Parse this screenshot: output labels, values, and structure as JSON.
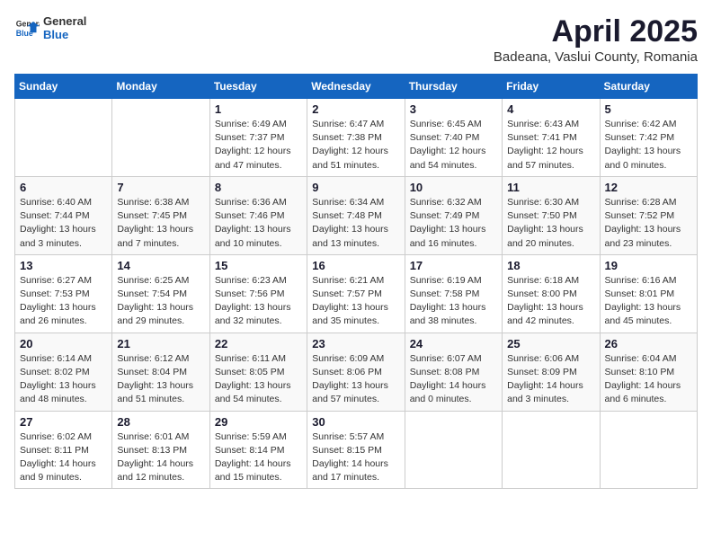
{
  "header": {
    "logo_general": "General",
    "logo_blue": "Blue",
    "title": "April 2025",
    "subtitle": "Badeana, Vaslui County, Romania"
  },
  "calendar": {
    "days_of_week": [
      "Sunday",
      "Monday",
      "Tuesday",
      "Wednesday",
      "Thursday",
      "Friday",
      "Saturday"
    ],
    "weeks": [
      [
        {
          "day": "",
          "detail": ""
        },
        {
          "day": "",
          "detail": ""
        },
        {
          "day": "1",
          "detail": "Sunrise: 6:49 AM\nSunset: 7:37 PM\nDaylight: 12 hours\nand 47 minutes."
        },
        {
          "day": "2",
          "detail": "Sunrise: 6:47 AM\nSunset: 7:38 PM\nDaylight: 12 hours\nand 51 minutes."
        },
        {
          "day": "3",
          "detail": "Sunrise: 6:45 AM\nSunset: 7:40 PM\nDaylight: 12 hours\nand 54 minutes."
        },
        {
          "day": "4",
          "detail": "Sunrise: 6:43 AM\nSunset: 7:41 PM\nDaylight: 12 hours\nand 57 minutes."
        },
        {
          "day": "5",
          "detail": "Sunrise: 6:42 AM\nSunset: 7:42 PM\nDaylight: 13 hours\nand 0 minutes."
        }
      ],
      [
        {
          "day": "6",
          "detail": "Sunrise: 6:40 AM\nSunset: 7:44 PM\nDaylight: 13 hours\nand 3 minutes."
        },
        {
          "day": "7",
          "detail": "Sunrise: 6:38 AM\nSunset: 7:45 PM\nDaylight: 13 hours\nand 7 minutes."
        },
        {
          "day": "8",
          "detail": "Sunrise: 6:36 AM\nSunset: 7:46 PM\nDaylight: 13 hours\nand 10 minutes."
        },
        {
          "day": "9",
          "detail": "Sunrise: 6:34 AM\nSunset: 7:48 PM\nDaylight: 13 hours\nand 13 minutes."
        },
        {
          "day": "10",
          "detail": "Sunrise: 6:32 AM\nSunset: 7:49 PM\nDaylight: 13 hours\nand 16 minutes."
        },
        {
          "day": "11",
          "detail": "Sunrise: 6:30 AM\nSunset: 7:50 PM\nDaylight: 13 hours\nand 20 minutes."
        },
        {
          "day": "12",
          "detail": "Sunrise: 6:28 AM\nSunset: 7:52 PM\nDaylight: 13 hours\nand 23 minutes."
        }
      ],
      [
        {
          "day": "13",
          "detail": "Sunrise: 6:27 AM\nSunset: 7:53 PM\nDaylight: 13 hours\nand 26 minutes."
        },
        {
          "day": "14",
          "detail": "Sunrise: 6:25 AM\nSunset: 7:54 PM\nDaylight: 13 hours\nand 29 minutes."
        },
        {
          "day": "15",
          "detail": "Sunrise: 6:23 AM\nSunset: 7:56 PM\nDaylight: 13 hours\nand 32 minutes."
        },
        {
          "day": "16",
          "detail": "Sunrise: 6:21 AM\nSunset: 7:57 PM\nDaylight: 13 hours\nand 35 minutes."
        },
        {
          "day": "17",
          "detail": "Sunrise: 6:19 AM\nSunset: 7:58 PM\nDaylight: 13 hours\nand 38 minutes."
        },
        {
          "day": "18",
          "detail": "Sunrise: 6:18 AM\nSunset: 8:00 PM\nDaylight: 13 hours\nand 42 minutes."
        },
        {
          "day": "19",
          "detail": "Sunrise: 6:16 AM\nSunset: 8:01 PM\nDaylight: 13 hours\nand 45 minutes."
        }
      ],
      [
        {
          "day": "20",
          "detail": "Sunrise: 6:14 AM\nSunset: 8:02 PM\nDaylight: 13 hours\nand 48 minutes."
        },
        {
          "day": "21",
          "detail": "Sunrise: 6:12 AM\nSunset: 8:04 PM\nDaylight: 13 hours\nand 51 minutes."
        },
        {
          "day": "22",
          "detail": "Sunrise: 6:11 AM\nSunset: 8:05 PM\nDaylight: 13 hours\nand 54 minutes."
        },
        {
          "day": "23",
          "detail": "Sunrise: 6:09 AM\nSunset: 8:06 PM\nDaylight: 13 hours\nand 57 minutes."
        },
        {
          "day": "24",
          "detail": "Sunrise: 6:07 AM\nSunset: 8:08 PM\nDaylight: 14 hours\nand 0 minutes."
        },
        {
          "day": "25",
          "detail": "Sunrise: 6:06 AM\nSunset: 8:09 PM\nDaylight: 14 hours\nand 3 minutes."
        },
        {
          "day": "26",
          "detail": "Sunrise: 6:04 AM\nSunset: 8:10 PM\nDaylight: 14 hours\nand 6 minutes."
        }
      ],
      [
        {
          "day": "27",
          "detail": "Sunrise: 6:02 AM\nSunset: 8:11 PM\nDaylight: 14 hours\nand 9 minutes."
        },
        {
          "day": "28",
          "detail": "Sunrise: 6:01 AM\nSunset: 8:13 PM\nDaylight: 14 hours\nand 12 minutes."
        },
        {
          "day": "29",
          "detail": "Sunrise: 5:59 AM\nSunset: 8:14 PM\nDaylight: 14 hours\nand 15 minutes."
        },
        {
          "day": "30",
          "detail": "Sunrise: 5:57 AM\nSunset: 8:15 PM\nDaylight: 14 hours\nand 17 minutes."
        },
        {
          "day": "",
          "detail": ""
        },
        {
          "day": "",
          "detail": ""
        },
        {
          "day": "",
          "detail": ""
        }
      ]
    ]
  }
}
